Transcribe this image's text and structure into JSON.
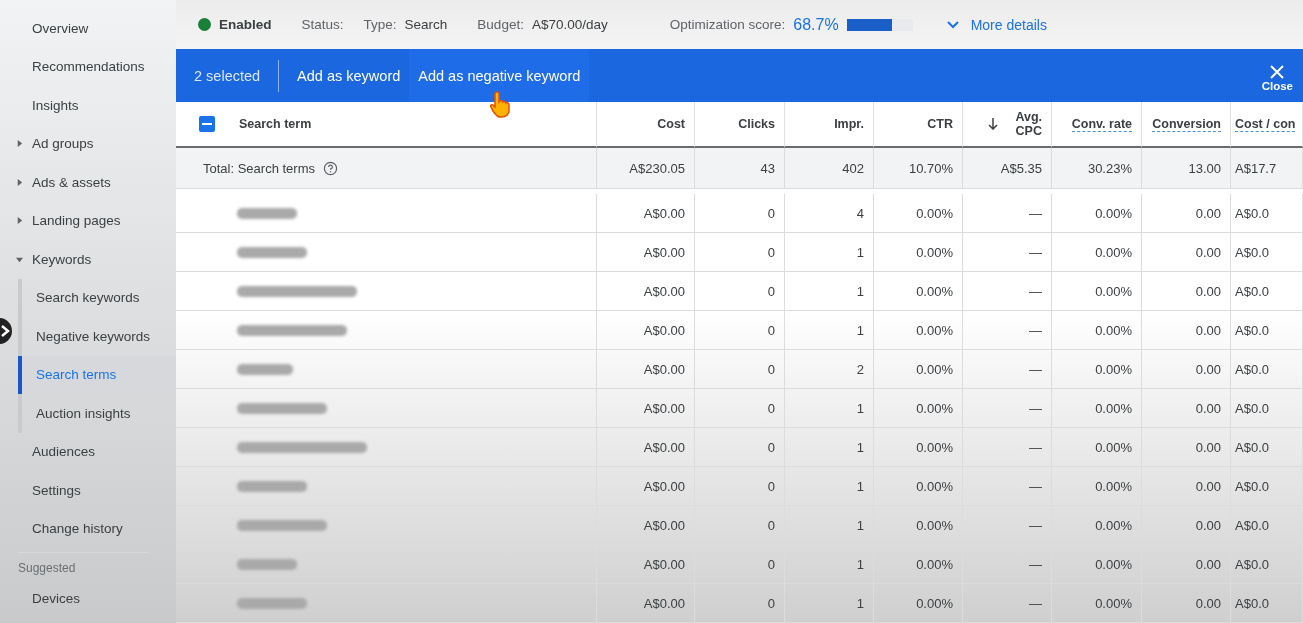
{
  "sidebar": {
    "items": [
      {
        "label": "Overview",
        "selected": false
      },
      {
        "label": "Recommendations",
        "selected": false
      },
      {
        "label": "Insights",
        "selected": false
      },
      {
        "label": "Ad groups",
        "selected": false,
        "expanded": false
      },
      {
        "label": "Ads & assets",
        "selected": false,
        "expanded": false
      },
      {
        "label": "Landing pages",
        "selected": false,
        "expanded": false
      },
      {
        "label": "Keywords",
        "selected": false,
        "expanded": true,
        "children": [
          {
            "label": "Search keywords",
            "selected": false
          },
          {
            "label": "Negative keywords",
            "selected": false
          },
          {
            "label": "Search terms",
            "selected": true
          },
          {
            "label": "Auction insights",
            "selected": false
          }
        ]
      },
      {
        "label": "Audiences",
        "selected": false
      },
      {
        "label": "Settings",
        "selected": false
      },
      {
        "label": "Change history",
        "selected": false
      }
    ],
    "section_title": "Suggested",
    "suggested_items": [
      {
        "label": "Devices",
        "selected": false
      }
    ]
  },
  "status_bar": {
    "status": "Enabled",
    "status_label": "Status:",
    "type_label": "Type:",
    "type": "Search",
    "budget_label": "Budget:",
    "budget": "A$70.00/day",
    "score_label": "Optimization score:",
    "score": "68.7%",
    "level": 0.687,
    "more": "More details"
  },
  "selection_bar": {
    "count": "2 selected",
    "actions": [
      "Add as keyword",
      "Add as negative keyword"
    ],
    "close": "Close"
  },
  "table": {
    "header_checkbox": {
      "indeterminate": true
    },
    "term_header": "Search term",
    "columns": [
      {
        "label": "Cost",
        "underlined": false,
        "sorted": false
      },
      {
        "label": "Clicks",
        "underlined": false,
        "sorted": false
      },
      {
        "label": "Impr.",
        "underlined": false,
        "sorted": false
      },
      {
        "label": "CTR",
        "underlined": false,
        "sorted": false
      },
      {
        "label": "Avg. CPC",
        "underlined": false,
        "sorted": true
      },
      {
        "label": "Conv. rate",
        "underlined": true,
        "sorted": false
      },
      {
        "label": "Conversion",
        "underlined": true,
        "sorted": false
      },
      {
        "label": "Cost / con",
        "underlined": true,
        "sorted": false
      }
    ],
    "total": {
      "label": "Total: Search terms",
      "values": [
        "A$230.05",
        "43",
        "402",
        "10.70%",
        "A$5.35",
        "30.23%",
        "13.00",
        "A$17.7"
      ]
    },
    "rows": [
      [
        "A$0.00",
        "0",
        "4",
        "0.00%",
        "—",
        "0.00%",
        "0.00",
        "A$0.0"
      ],
      [
        "A$0.00",
        "0",
        "1",
        "0.00%",
        "—",
        "0.00%",
        "0.00",
        "A$0.0"
      ],
      [
        "A$0.00",
        "0",
        "1",
        "0.00%",
        "—",
        "0.00%",
        "0.00",
        "A$0.0"
      ],
      [
        "A$0.00",
        "0",
        "1",
        "0.00%",
        "—",
        "0.00%",
        "0.00",
        "A$0.0"
      ],
      [
        "A$0.00",
        "0",
        "2",
        "0.00%",
        "—",
        "0.00%",
        "0.00",
        "A$0.0"
      ],
      [
        "A$0.00",
        "0",
        "1",
        "0.00%",
        "—",
        "0.00%",
        "0.00",
        "A$0.0"
      ],
      [
        "A$0.00",
        "0",
        "1",
        "0.00%",
        "—",
        "0.00%",
        "0.00",
        "A$0.0"
      ],
      [
        "A$0.00",
        "0",
        "1",
        "0.00%",
        "—",
        "0.00%",
        "0.00",
        "A$0.0"
      ],
      [
        "A$0.00",
        "0",
        "1",
        "0.00%",
        "—",
        "0.00%",
        "0.00",
        "A$0.0"
      ],
      [
        "A$0.00",
        "0",
        "1",
        "0.00%",
        "—",
        "0.00%",
        "0.00",
        "A$0.0"
      ],
      [
        "A$0.00",
        "0",
        "1",
        "0.00%",
        "—",
        "0.00%",
        "0.00",
        "A$0.0"
      ]
    ]
  }
}
